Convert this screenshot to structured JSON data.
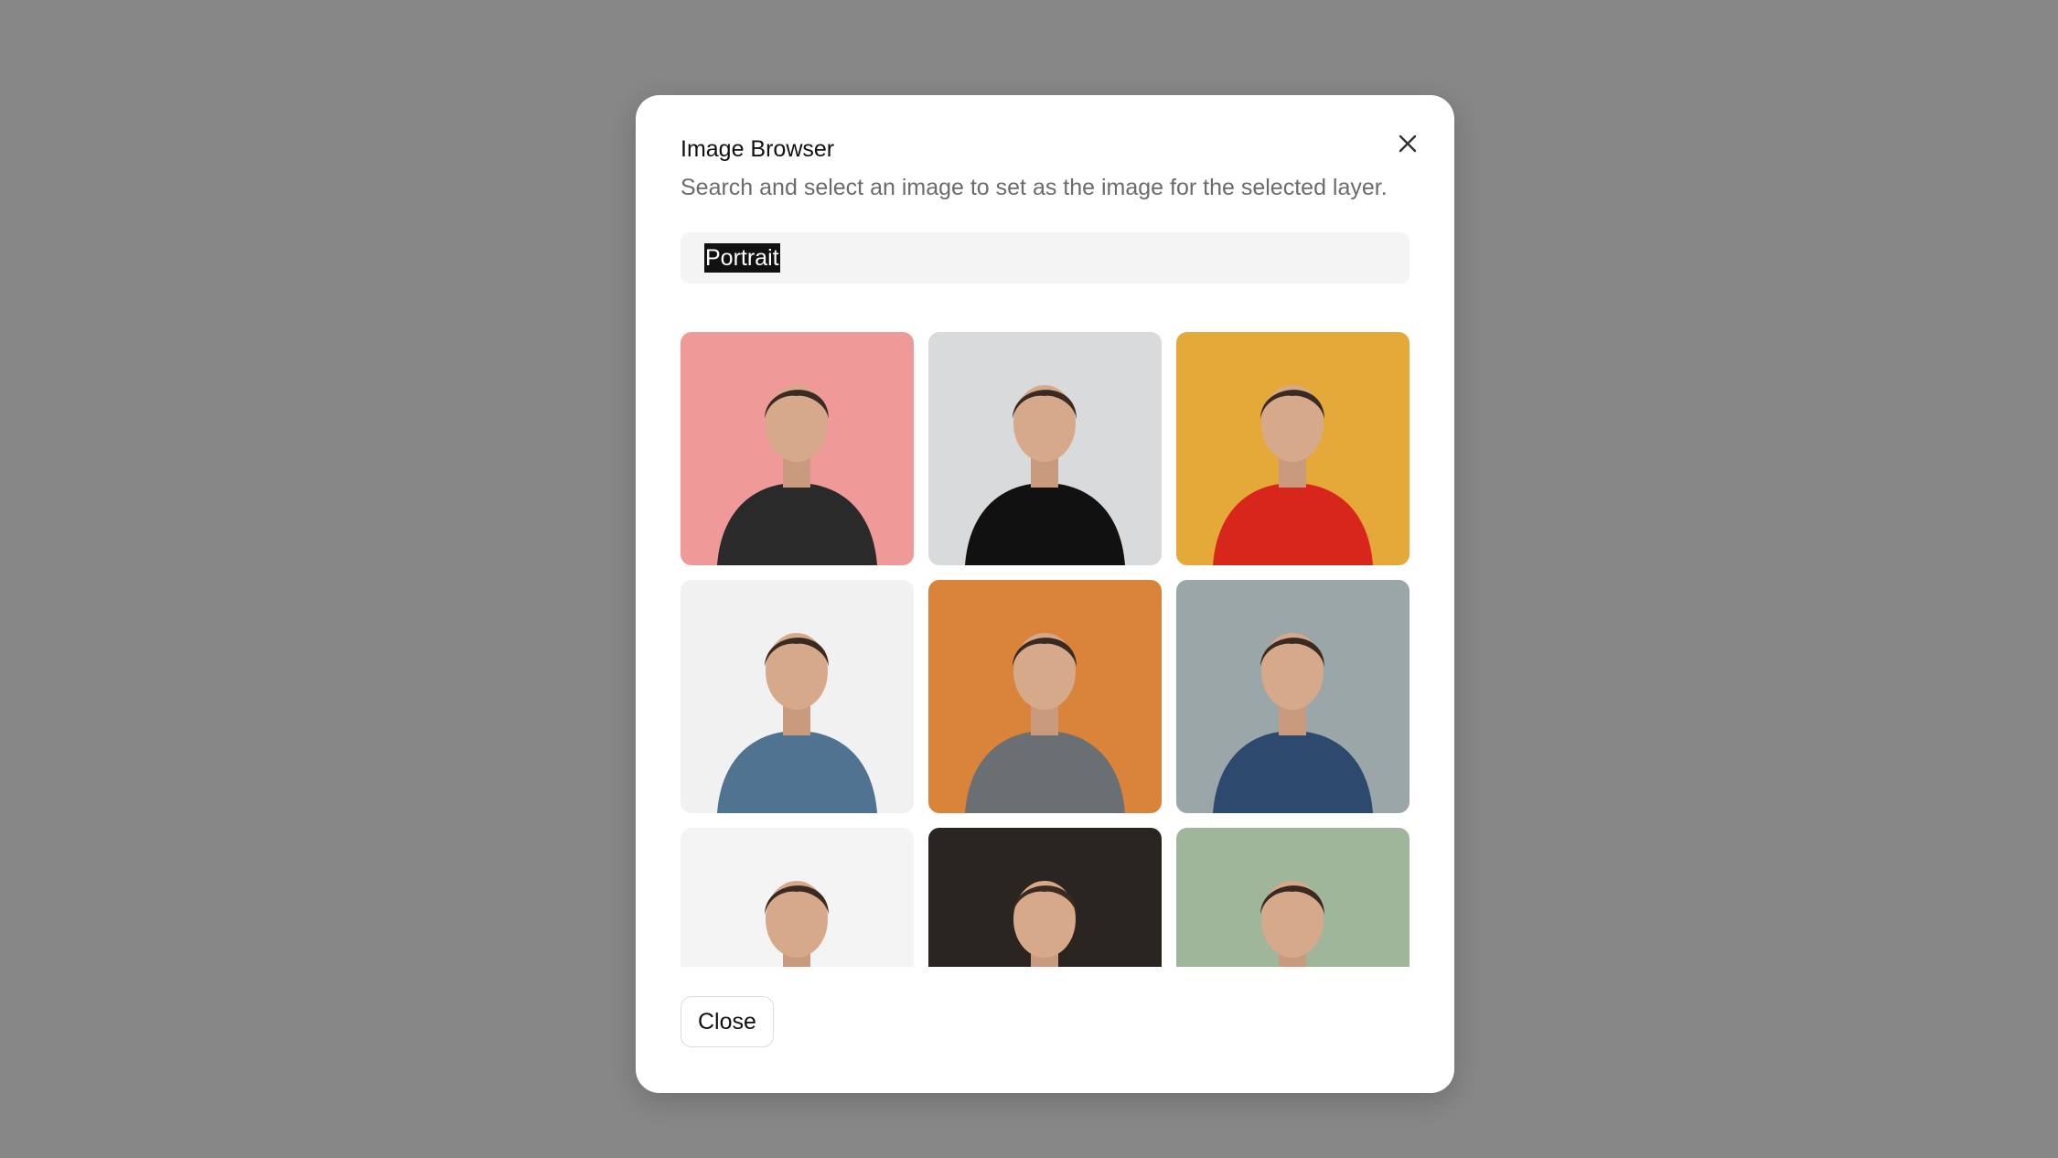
{
  "dialog": {
    "title": "Image Browser",
    "subtitle": "Search and select an image to set as the image for the selected layer.",
    "close_button_label": "Close",
    "close_icon": "close-icon"
  },
  "search": {
    "value": "Portrait",
    "selected": true
  },
  "results": [
    {
      "name": "photo-woman-pink-background",
      "bg": "#ef9a98",
      "subject": "#2a2a2a"
    },
    {
      "name": "photo-woman-black-turtleneck",
      "bg": "#d9dadb",
      "subject": "#111111"
    },
    {
      "name": "photo-woman-red-top-yellow",
      "bg": "#e5a93a",
      "subject": "#d9261c"
    },
    {
      "name": "photo-man-blue-vneck",
      "bg": "#f1f1f1",
      "subject": "#4f7390"
    },
    {
      "name": "photo-woman-grey-blazer",
      "bg": "#d9843a",
      "subject": "#6a6f74"
    },
    {
      "name": "photo-man-patterned-shirt",
      "bg": "#9aa6a8",
      "subject": "#2d4a6e"
    },
    {
      "name": "photo-man-glasses",
      "bg": "#f4f4f4",
      "subject": "#8c98a4"
    },
    {
      "name": "photo-woman-closeup-dark",
      "bg": "#2b2522",
      "subject": "#b98668"
    },
    {
      "name": "photo-woman-laughing-plants",
      "bg": "#9fb69a",
      "subject": "#3c2a22"
    }
  ]
}
